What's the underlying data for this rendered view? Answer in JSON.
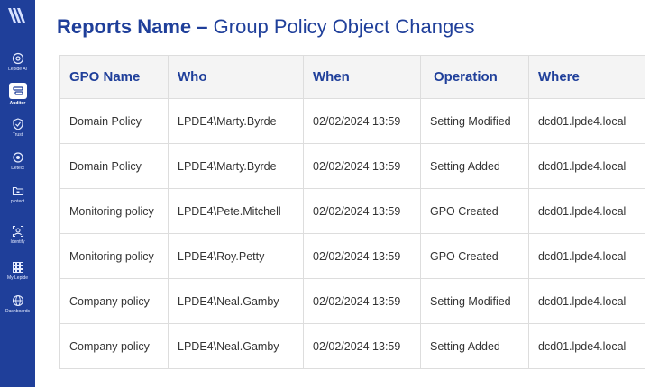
{
  "sidebar": {
    "items": [
      {
        "label": "Lepide AI",
        "icon": "ai-icon"
      },
      {
        "label": "Auditor",
        "icon": "auditor-icon",
        "active": true
      },
      {
        "label": "Trust",
        "icon": "shield-icon"
      },
      {
        "label": "Detect",
        "icon": "detect-icon"
      },
      {
        "label": "protect",
        "icon": "folder-lock-icon"
      },
      {
        "label": "Identify",
        "icon": "identify-icon"
      },
      {
        "label": "My Lepide",
        "icon": "grid-icon"
      },
      {
        "label": "Dashboards",
        "icon": "globe-icon"
      }
    ]
  },
  "page": {
    "title_strong": "Reports Name –",
    "title_light": "Group Policy Object Changes"
  },
  "table": {
    "headers": [
      "GPO Name",
      "Who",
      "When",
      "Operation",
      "Where"
    ],
    "rows": [
      [
        "Domain Policy",
        "LPDE4\\Marty.Byrde",
        "02/02/2024 13:59",
        "Setting Modified",
        "dcd01.lpde4.local"
      ],
      [
        "Domain Policy",
        "LPDE4\\Marty.Byrde",
        "02/02/2024 13:59",
        "Setting Added",
        "dcd01.lpde4.local"
      ],
      [
        "Monitoring policy",
        "LPDE4\\Pete.Mitchell",
        "02/02/2024 13:59",
        "GPO Created",
        "dcd01.lpde4.local"
      ],
      [
        "Monitoring policy",
        "LPDE4\\Roy.Petty",
        "02/02/2024 13:59",
        "GPO Created",
        "dcd01.lpde4.local"
      ],
      [
        "Company policy",
        "LPDE4\\Neal.Gamby",
        "02/02/2024 13:59",
        "Setting Modified",
        "dcd01.lpde4.local"
      ],
      [
        "Company policy",
        "LPDE4\\Neal.Gamby",
        "02/02/2024 13:59",
        "Setting Added",
        "dcd01.lpde4.local"
      ]
    ]
  },
  "colors": {
    "sidebar": "#1f3f9a",
    "accent": "#1f3f9a",
    "header_bg": "#f4f4f4",
    "border": "#dddddd"
  }
}
